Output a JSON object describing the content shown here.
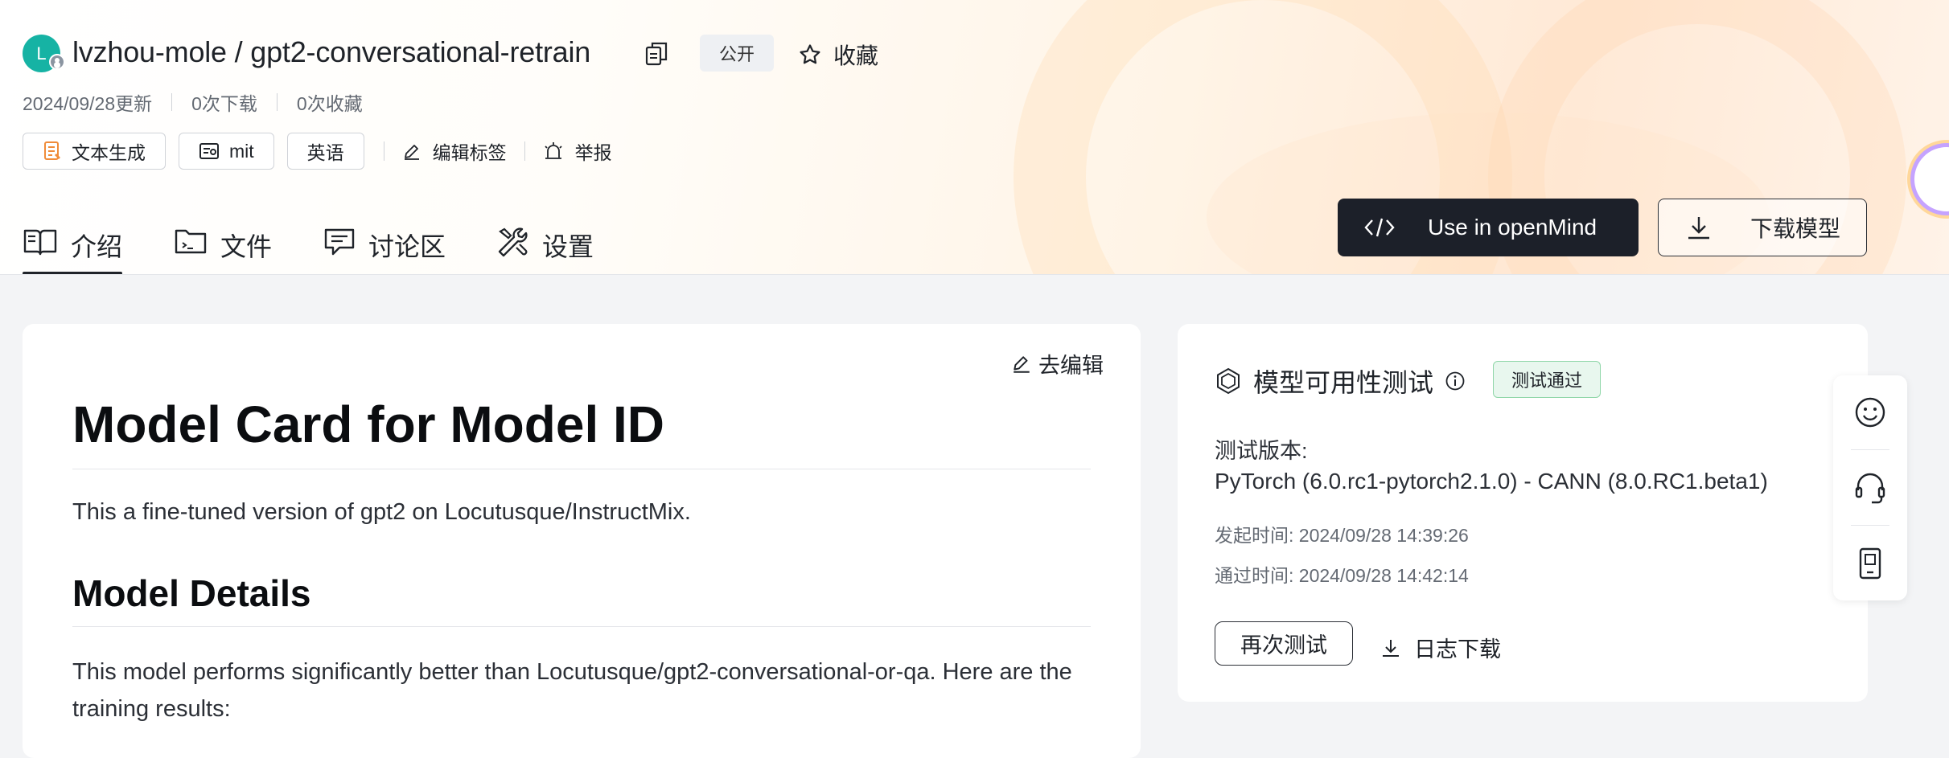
{
  "repo": {
    "avatar_letter": "L",
    "title": "lvzhou-mole / gpt2-conversational-retrain",
    "visibility": "公开",
    "favorite_label": "收藏"
  },
  "meta": {
    "updated": "2024/09/28更新",
    "downloads": "0次下载",
    "favorites": "0次收藏"
  },
  "tags": {
    "items": [
      {
        "label": "文本生成",
        "icon": "text-generation-icon"
      },
      {
        "label": "mit",
        "icon": "license-icon"
      },
      {
        "label": "英语",
        "icon": ""
      }
    ],
    "edit_label": "编辑标签",
    "report_label": "举报"
  },
  "tabs": [
    {
      "label": "介绍",
      "icon": "book-icon",
      "active": true
    },
    {
      "label": "文件",
      "icon": "folder-icon",
      "active": false
    },
    {
      "label": "讨论区",
      "icon": "chat-icon",
      "active": false
    },
    {
      "label": "设置",
      "icon": "tools-icon",
      "active": false
    }
  ],
  "actions": {
    "openmind_label": "Use in openMind",
    "download_label": "下载模型"
  },
  "readme": {
    "edit_label": "去编辑",
    "h1": "Model Card for Model ID",
    "p1": "This a fine-tuned version of gpt2 on Locutusque/InstructMix.",
    "h2": "Model Details",
    "p2": "This model performs significantly better than Locutusque/gpt2-conversational-or-qa. Here are the training results:"
  },
  "test_panel": {
    "title": "模型可用性测试",
    "status": "测试通过",
    "version_label": "测试版本:",
    "version_value": "PyTorch (6.0.rc1-pytorch2.1.0) - CANN (8.0.RC1.beta1)",
    "start_time": "发起时间: 2024/09/28 14:39:26",
    "pass_time": "通过时间: 2024/09/28 14:42:14",
    "retest_label": "再次测试",
    "log_label": "日志下载"
  },
  "float_bar": [
    "smile-icon",
    "headset-icon",
    "mobile-icon"
  ],
  "colors": {
    "accent_dark": "#1c2029",
    "pass_bg": "#e8f7ee",
    "pass_border": "#8fd6a8",
    "avatar": "#16b3a4"
  }
}
